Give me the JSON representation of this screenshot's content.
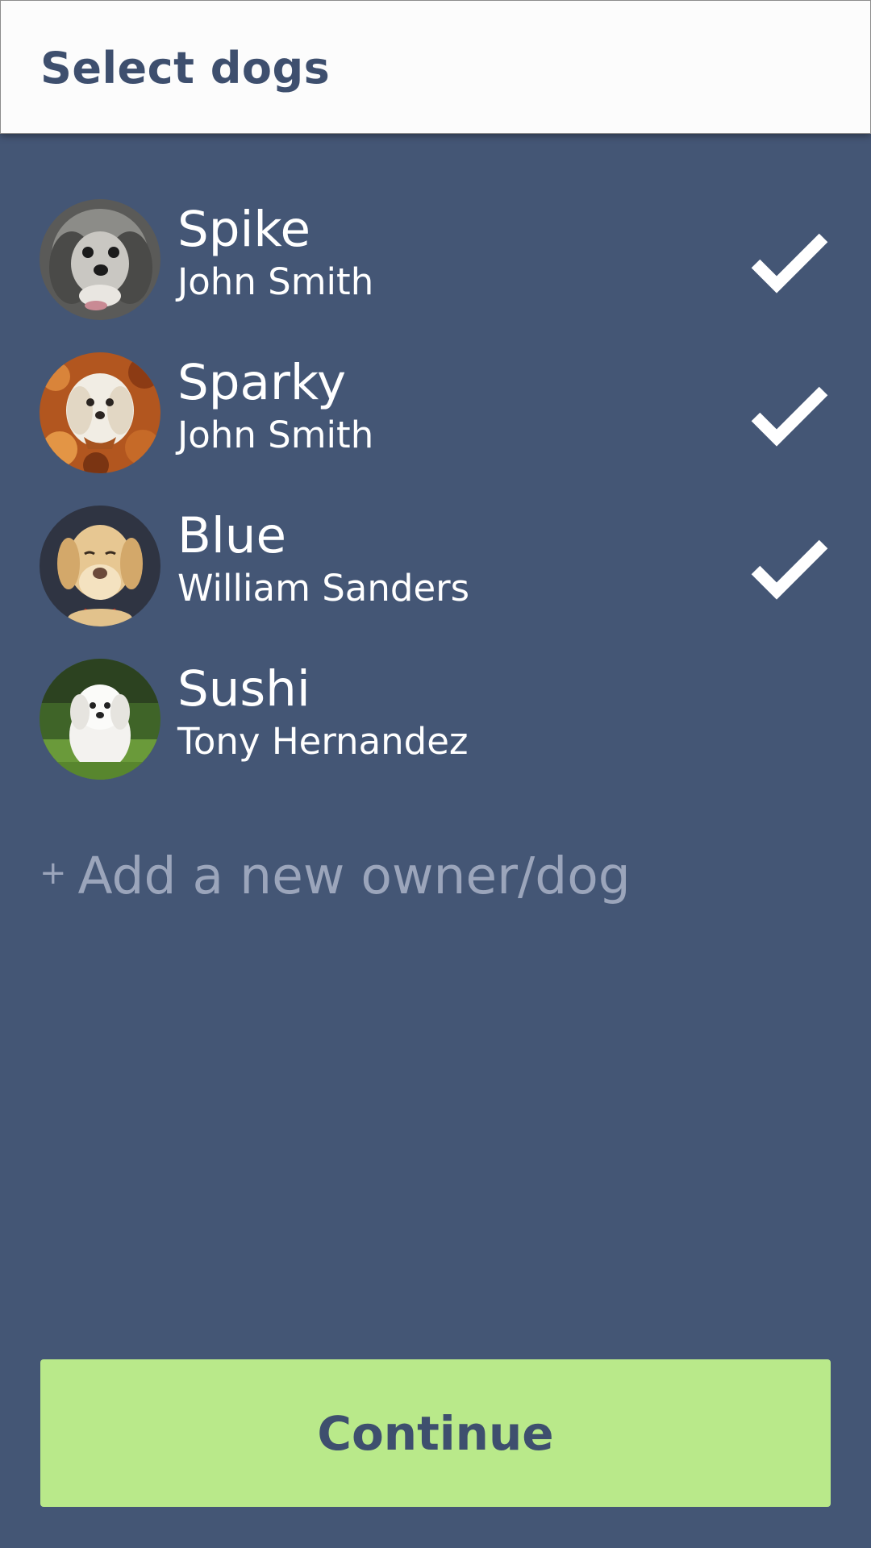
{
  "header": {
    "title": "Select dogs"
  },
  "dogs": [
    {
      "name": "Spike",
      "owner": "John Smith",
      "selected": true,
      "photo": "shih-tzu-gray"
    },
    {
      "name": "Sparky",
      "owner": "John Smith",
      "selected": true,
      "photo": "shih-tzu-in-leaves"
    },
    {
      "name": "Blue",
      "owner": "William Sanders",
      "selected": true,
      "photo": "labrador-yellow"
    },
    {
      "name": "Sushi",
      "owner": "Tony Hernandez",
      "selected": false,
      "photo": "maltese-on-grass"
    }
  ],
  "add_new": {
    "plus": "+",
    "label": "Add a new owner/dog"
  },
  "footer": {
    "continue_label": "Continue"
  },
  "icons": {
    "selected": "check-icon"
  },
  "colors": {
    "background": "#445675",
    "header_bg": "#fcfcfc",
    "title": "#3e4f6e",
    "accent_button": "#b9e98a",
    "muted_text": "#9ba5bb",
    "check": "#ffffff"
  }
}
